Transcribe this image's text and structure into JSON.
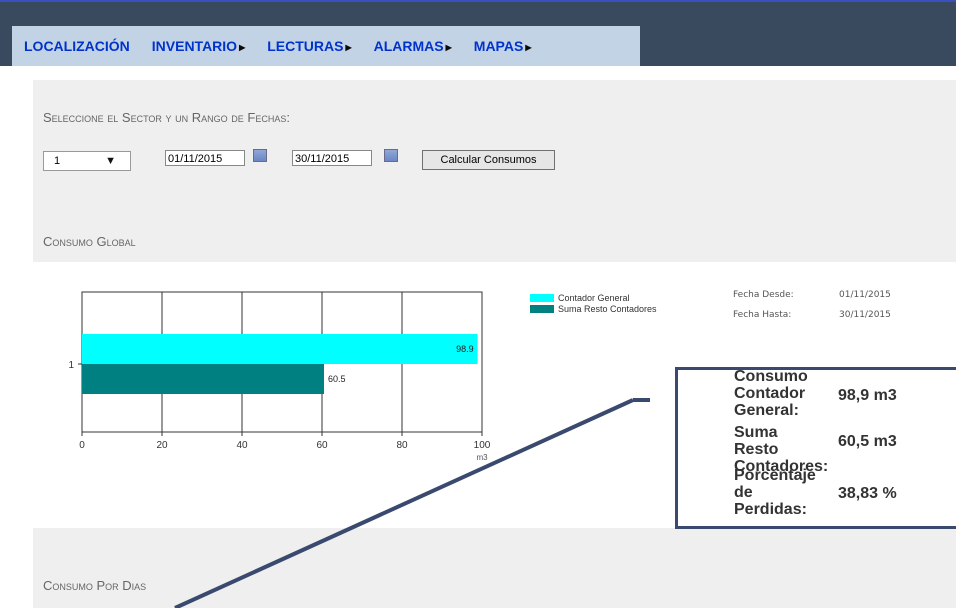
{
  "nav": {
    "items": [
      {
        "label": "LOCALIZACIÓN",
        "has_arrow": false
      },
      {
        "label": "INVENTARIO",
        "has_arrow": true
      },
      {
        "label": "LECTURAS",
        "has_arrow": true
      },
      {
        "label": "ALARMAS",
        "has_arrow": true
      },
      {
        "label": "MAPAS",
        "has_arrow": true
      }
    ],
    "arrow_glyph": "▶"
  },
  "filter": {
    "heading": "Seleccione el Sector y un Rango de Fechas:",
    "sector_value": "1",
    "sector_arrow": "▼",
    "date_from": "01/11/2015",
    "date_to": "30/11/2015",
    "calc_button": "Calcular Consumos"
  },
  "sections": {
    "global": "Consumo Global",
    "por_dias": "Consumo Por Dias"
  },
  "chart_data": {
    "type": "bar",
    "orientation": "horizontal",
    "categories": [
      "1"
    ],
    "series": [
      {
        "name": "Contador General",
        "values": [
          98.9
        ],
        "color": "#00ffff",
        "label": "98.9"
      },
      {
        "name": "Suma Resto Contadores",
        "values": [
          60.5
        ],
        "color": "#008080",
        "label": "60.5"
      }
    ],
    "xlim": [
      0,
      100
    ],
    "xticks": [
      0,
      20,
      40,
      60,
      80,
      100
    ],
    "xlabel": "m3",
    "grid": true,
    "legend": "right"
  },
  "dates_info": {
    "from_label": "Fecha Desde:",
    "from_value": "01/11/2015",
    "to_label": "Fecha Hasta:",
    "to_value": "30/11/2015"
  },
  "summary": {
    "general_label": "Consumo Contador General:",
    "general_value": "98,9 m3",
    "resto_label": "Suma Resto Contadores:",
    "resto_value": "60,5 m3",
    "perdidas_label": "Porcentaje de Perdidas:",
    "perdidas_value": "38,83 %"
  },
  "colors": {
    "header": "#3a4a5e",
    "nav_bg": "#c3d3e6",
    "nav_text": "#0033cc",
    "panel_bg": "#efefef",
    "callout": "#3a4a6e"
  }
}
